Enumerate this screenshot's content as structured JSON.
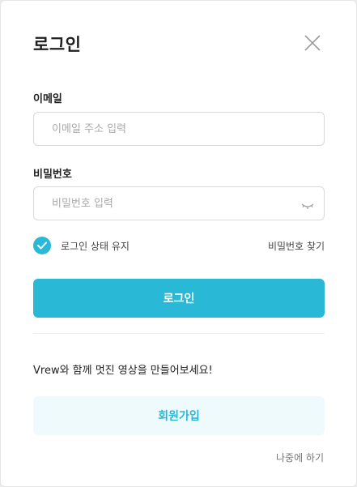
{
  "modal": {
    "title": "로그인",
    "close_icon": "close-icon"
  },
  "email": {
    "label": "이메일",
    "placeholder": "이메일 주소 입력",
    "value": ""
  },
  "password": {
    "label": "비밀번호",
    "placeholder": "비밀번호 입력",
    "value": "",
    "toggle_icon": "eye-closed-icon"
  },
  "options": {
    "keep_logged_in_label": "로그인 상태 유지",
    "keep_logged_in_checked": true,
    "find_password_label": "비밀번호 찾기"
  },
  "actions": {
    "login_label": "로그인",
    "promo_text": "Vrew와 함께 멋진 영상을 만들어보세요!",
    "signup_label": "회원가입",
    "later_label": "나중에 하기"
  },
  "colors": {
    "accent": "#29b8d6",
    "signup_bg": "#effafc"
  }
}
